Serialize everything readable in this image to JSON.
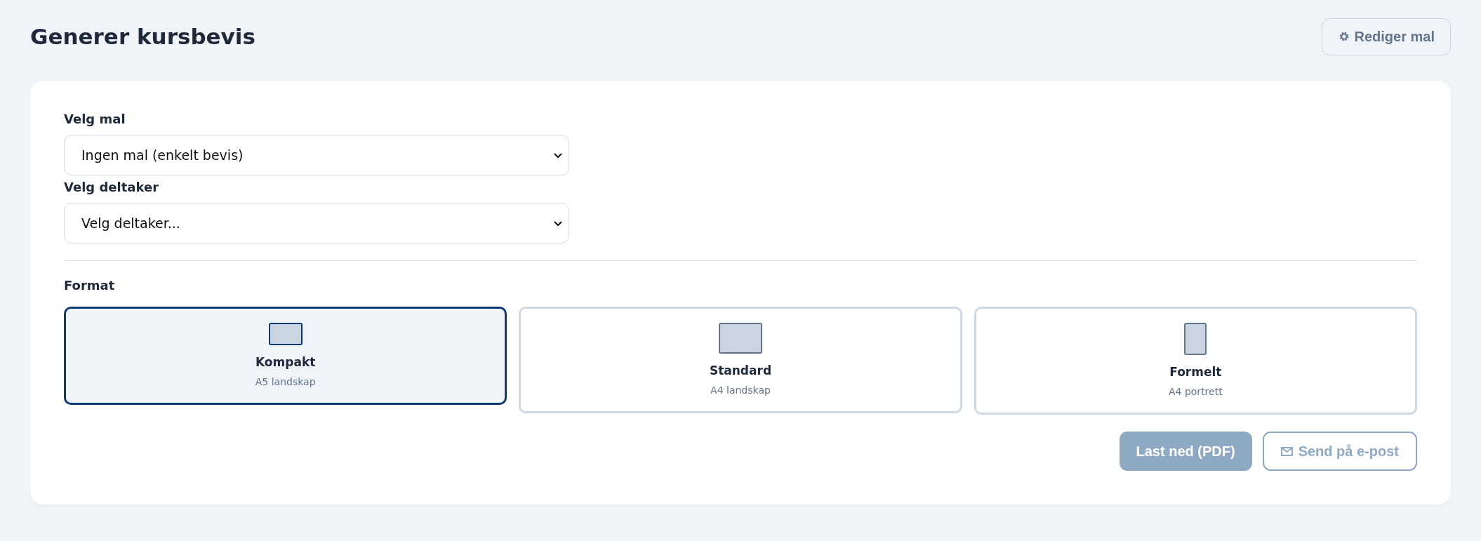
{
  "header": {
    "title": "Generer kursbevis",
    "edit_button": {
      "label": "Rediger mal"
    }
  },
  "fields": [
    {
      "label": "Velg mal",
      "value": "Ingen mal (enkelt bevis)"
    },
    {
      "label": "Velg deltaker",
      "value": "Velg deltaker..."
    }
  ],
  "format": {
    "label": "Format",
    "options": [
      {
        "kind": "small-landscape",
        "title": "Kompakt",
        "subtitle": "A5 landskap",
        "selected": true
      },
      {
        "kind": "landscape",
        "title": "Standard",
        "subtitle": "A4 landskap",
        "selected": false
      },
      {
        "kind": "portrait",
        "title": "Formelt",
        "subtitle": "A4 portrett",
        "selected": false
      }
    ]
  },
  "actions": [
    {
      "kind": "primary",
      "label": "Last ned (PDF)",
      "disabled": true
    },
    {
      "kind": "email",
      "label": "Send på e-post",
      "disabled": true
    }
  ]
}
